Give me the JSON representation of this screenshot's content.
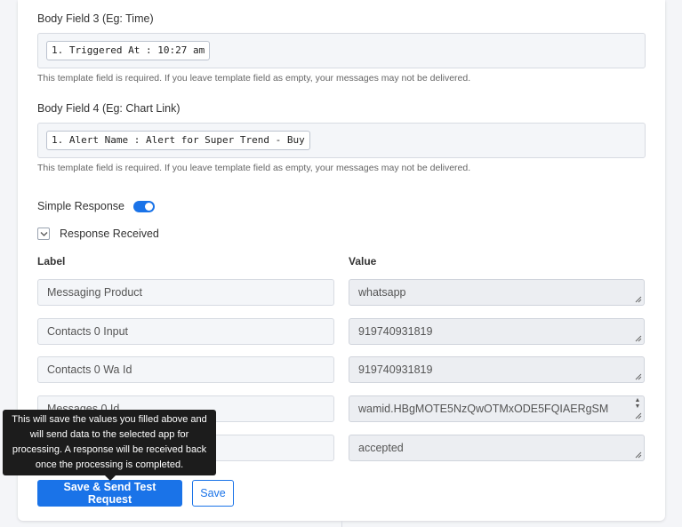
{
  "body_field_3": {
    "label": "Body Field 3 (Eg: Time)",
    "chip": "1. Triggered At : 10:27 am",
    "hint": "This template field is required. If you leave template field as empty, your messages may not be delivered."
  },
  "body_field_4": {
    "label": "Body Field 4 (Eg: Chart Link)",
    "chip": "1. Alert Name : Alert for Super Trend - Buy",
    "hint": "This template field is required. If you leave template field as empty, your messages may not be delivered."
  },
  "simple_response": {
    "label": "Simple Response",
    "enabled": true
  },
  "response_received": {
    "label": "Response Received",
    "expanded": true
  },
  "table": {
    "label_header": "Label",
    "value_header": "Value",
    "rows": [
      {
        "label": "Messaging Product",
        "value": "whatsapp"
      },
      {
        "label": "Contacts 0 Input",
        "value": "919740931819"
      },
      {
        "label": "Contacts 0 Wa Id",
        "value": "919740931819"
      },
      {
        "label": "Messages 0 Id",
        "value": "wamid.HBgMOTE5NzQwOTMxODE5FQIAERgSM"
      },
      {
        "label": "",
        "value": "accepted"
      }
    ]
  },
  "buttons": {
    "send_test": "Save & Send Test Request",
    "save": "Save"
  },
  "tooltip": {
    "text": "This will save the values you filled above and will send data to the selected app for processing. A response will be received back once the processing is completed."
  },
  "colors": {
    "accent": "#1a73e8",
    "tooltip_bg": "#1c1c1c"
  }
}
